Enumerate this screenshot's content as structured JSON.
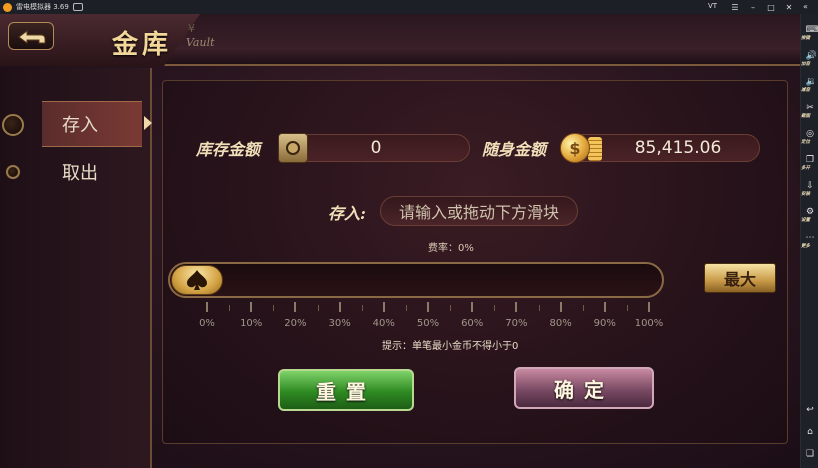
{
  "emulator": {
    "title": "雷电模拟器 3.69",
    "vt_label": "VT",
    "sidebar": [
      {
        "icon": "keyboard-icon",
        "label": "按键"
      },
      {
        "icon": "volume-up-icon",
        "label": "加音"
      },
      {
        "icon": "volume-down-icon",
        "label": "减音"
      },
      {
        "icon": "scissors-icon",
        "label": "截图"
      },
      {
        "icon": "location-icon",
        "label": "定位"
      },
      {
        "icon": "multi-instance-icon",
        "label": "多开"
      },
      {
        "icon": "install-icon",
        "label": "安装"
      },
      {
        "icon": "settings-icon",
        "label": "设置"
      },
      {
        "icon": "more-icon",
        "label": "更多"
      }
    ]
  },
  "header": {
    "title": "金库",
    "subtitle": "Vault",
    "subtitle_mark": "¥"
  },
  "tabs": [
    {
      "label": "存入",
      "active": true
    },
    {
      "label": "取出",
      "active": false
    }
  ],
  "vault": {
    "stored_label": "库存金额",
    "stored_value": "0",
    "carried_label": "随身金额",
    "carried_value": "85,415.06",
    "coin_symbol": "$"
  },
  "deposit": {
    "label": "存入:",
    "placeholder": "请输入或拖动下方滑块",
    "fee_text": "费率：0%",
    "max_label": "最大",
    "slider_value_percent": 0,
    "ticks": [
      "0%",
      "10%",
      "20%",
      "30%",
      "40%",
      "50%",
      "60%",
      "70%",
      "80%",
      "90%",
      "100%"
    ],
    "hint": "提示：单笔最小金币不得小于0",
    "reset_label": "重置",
    "confirm_label": "确定"
  },
  "colors": {
    "accent_gold": "#f3d79a",
    "reset_green": "#2f8a22",
    "confirm_mauve": "#7a4a64"
  }
}
